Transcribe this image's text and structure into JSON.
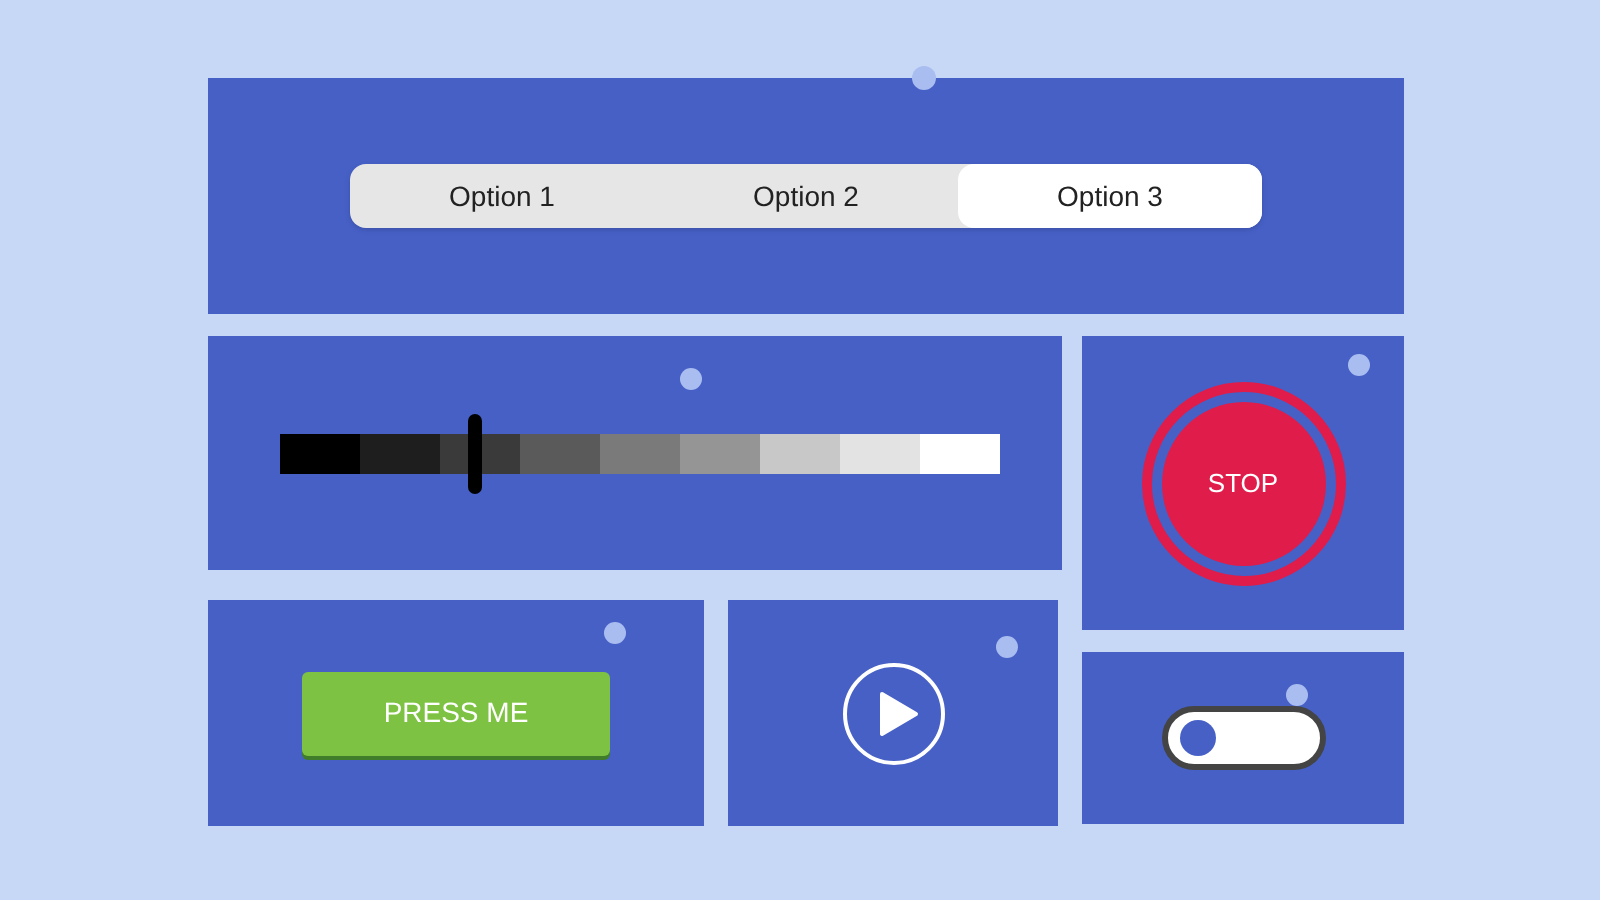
{
  "segmented_control": {
    "options": [
      {
        "label": "Option 1",
        "selected": false
      },
      {
        "label": "Option 2",
        "selected": false
      },
      {
        "label": "Option 3",
        "selected": true
      }
    ]
  },
  "grayscale_slider": {
    "level": 0.27
  },
  "stop_button": {
    "label": "STOP"
  },
  "press_button": {
    "label": "PRESS ME"
  },
  "play_button": {
    "kind": "play"
  },
  "toggle": {
    "on": false
  }
}
